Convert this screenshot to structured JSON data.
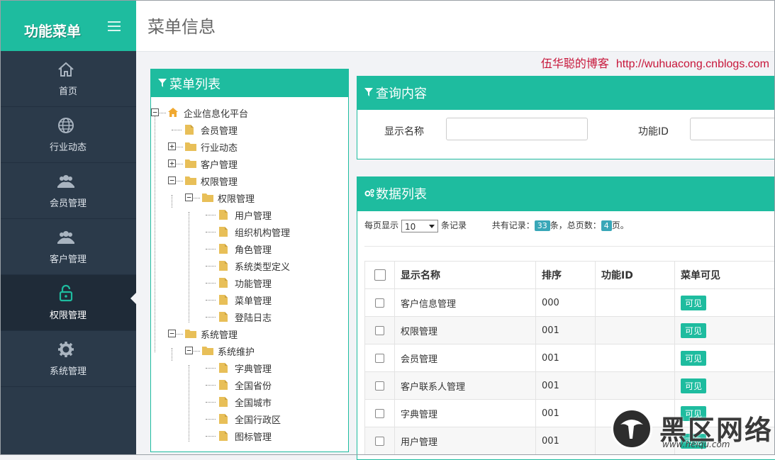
{
  "sidebar": {
    "title": "功能菜单",
    "items": [
      {
        "label": "首页",
        "icon": "home-icon"
      },
      {
        "label": "行业动态",
        "icon": "globe-icon"
      },
      {
        "label": "会员管理",
        "icon": "users-icon"
      },
      {
        "label": "客户管理",
        "icon": "users-icon"
      },
      {
        "label": "权限管理",
        "icon": "unlock-icon",
        "active": true
      },
      {
        "label": "系统管理",
        "icon": "gear-icon"
      }
    ]
  },
  "header": {
    "title": "菜单信息",
    "credit_text": "伍华聪的博客",
    "credit_url": "http://wuhuacong.cnblogs.com"
  },
  "tree_panel": {
    "title": "菜单列表",
    "nodes": [
      {
        "label": "企业信息化平台",
        "level": 0,
        "expand": "minus",
        "icon": "home"
      },
      {
        "label": "会员管理",
        "level": 1,
        "expand": "none",
        "icon": "doc"
      },
      {
        "label": "行业动态",
        "level": 1,
        "expand": "plus",
        "icon": "folder"
      },
      {
        "label": "客户管理",
        "level": 1,
        "expand": "plus",
        "icon": "folder"
      },
      {
        "label": "权限管理",
        "level": 1,
        "expand": "minus",
        "icon": "folder"
      },
      {
        "label": "权限管理",
        "level": 2,
        "expand": "minus",
        "icon": "folder"
      },
      {
        "label": "用户管理",
        "level": 3,
        "expand": "none",
        "icon": "doc"
      },
      {
        "label": "组织机构管理",
        "level": 3,
        "expand": "none",
        "icon": "doc"
      },
      {
        "label": "角色管理",
        "level": 3,
        "expand": "none",
        "icon": "doc"
      },
      {
        "label": "系统类型定义",
        "level": 3,
        "expand": "none",
        "icon": "doc"
      },
      {
        "label": "功能管理",
        "level": 3,
        "expand": "none",
        "icon": "doc"
      },
      {
        "label": "菜单管理",
        "level": 3,
        "expand": "none",
        "icon": "doc"
      },
      {
        "label": "登陆日志",
        "level": 3,
        "expand": "none",
        "icon": "doc"
      },
      {
        "label": "系统管理",
        "level": 1,
        "expand": "minus",
        "icon": "folder"
      },
      {
        "label": "系统维护",
        "level": 2,
        "expand": "minus",
        "icon": "folder"
      },
      {
        "label": "字典管理",
        "level": 3,
        "expand": "none",
        "icon": "doc"
      },
      {
        "label": "全国省份",
        "level": 3,
        "expand": "none",
        "icon": "doc"
      },
      {
        "label": "全国城市",
        "level": 3,
        "expand": "none",
        "icon": "doc"
      },
      {
        "label": "全国行政区",
        "level": 3,
        "expand": "none",
        "icon": "doc"
      },
      {
        "label": "图标管理",
        "level": 3,
        "expand": "none",
        "icon": "doc"
      }
    ]
  },
  "query_panel": {
    "title": "查询内容",
    "display_name_label": "显示名称",
    "display_name_value": "",
    "function_id_label": "功能ID",
    "function_id_value": ""
  },
  "data_panel": {
    "title": "数据列表",
    "page_size_prefix": "每页显示",
    "page_size": "10",
    "page_size_suffix": "条记录",
    "total_prefix": "共有记录：",
    "total_records": "33",
    "total_mid": "条，总页数：",
    "total_pages": "4",
    "total_suffix": "页。",
    "columns": [
      "显示名称",
      "排序",
      "功能ID",
      "菜单可见"
    ],
    "rows": [
      {
        "name": "客户信息管理",
        "order": "000",
        "function_id": "",
        "visible": "可见"
      },
      {
        "name": "权限管理",
        "order": "001",
        "function_id": "",
        "visible": "可见"
      },
      {
        "name": "会员管理",
        "order": "001",
        "function_id": "",
        "visible": "可见"
      },
      {
        "name": "客户联系人管理",
        "order": "001",
        "function_id": "",
        "visible": "可见"
      },
      {
        "name": "字典管理",
        "order": "001",
        "function_id": "",
        "visible": "可见"
      },
      {
        "name": "用户管理",
        "order": "001",
        "function_id": "",
        "visible": "可见"
      }
    ]
  },
  "watermark": {
    "text": "黑区网络",
    "url": "www.heiqu.com"
  },
  "colors": {
    "accent": "#1ebc9f",
    "sidebar_bg": "#2b3a4a",
    "sidebar_active": "#1f2b38",
    "credit_red": "#c7163a",
    "badge_blue": "#39a7b8"
  }
}
